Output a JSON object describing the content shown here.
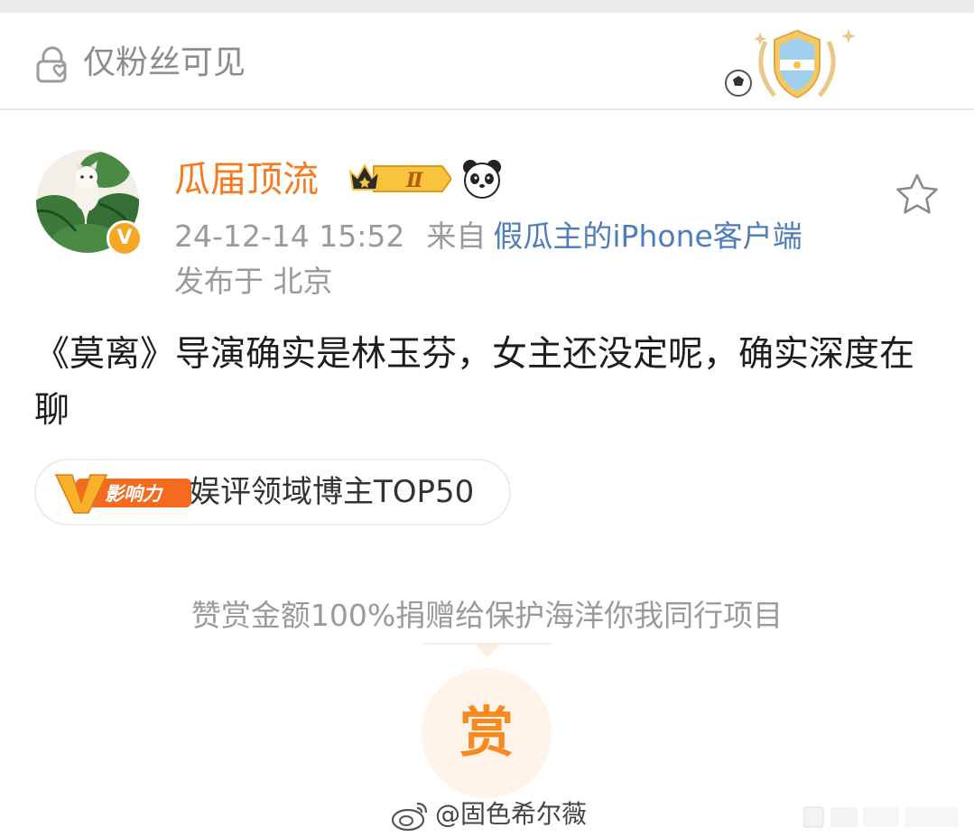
{
  "visibility": {
    "label": "仅粉丝可见"
  },
  "author": {
    "name": "瓜届顶流",
    "vip_level": "Ⅱ",
    "verified_mark": "V",
    "timestamp": "24-12-14 15:52",
    "from_label": "来自",
    "client": "假瓜主的iPhone客户端",
    "location_label": "发布于 北京"
  },
  "post": {
    "text": "《莫离》导演确实是林玉芬，女主还没定呢，确实深度在聊"
  },
  "influence": {
    "logo_text": "影响力",
    "tag_text": "娱评领域博主TOP50"
  },
  "reward": {
    "note": "赞赏金额100%捐赠给保护海洋你我同行项目",
    "button_label": "赏"
  },
  "watermark": {
    "text": "@固色希尔薇"
  },
  "colors": {
    "username": "#f77b1e",
    "client_link": "#4f7db8",
    "reward_accent": "#f7891e",
    "muted_text": "#9a9a9a"
  },
  "icons": [
    "lock-icon",
    "football-badge-icon",
    "vip-crown-icon",
    "panda-icon",
    "star-icon",
    "weibo-logo-icon"
  ]
}
